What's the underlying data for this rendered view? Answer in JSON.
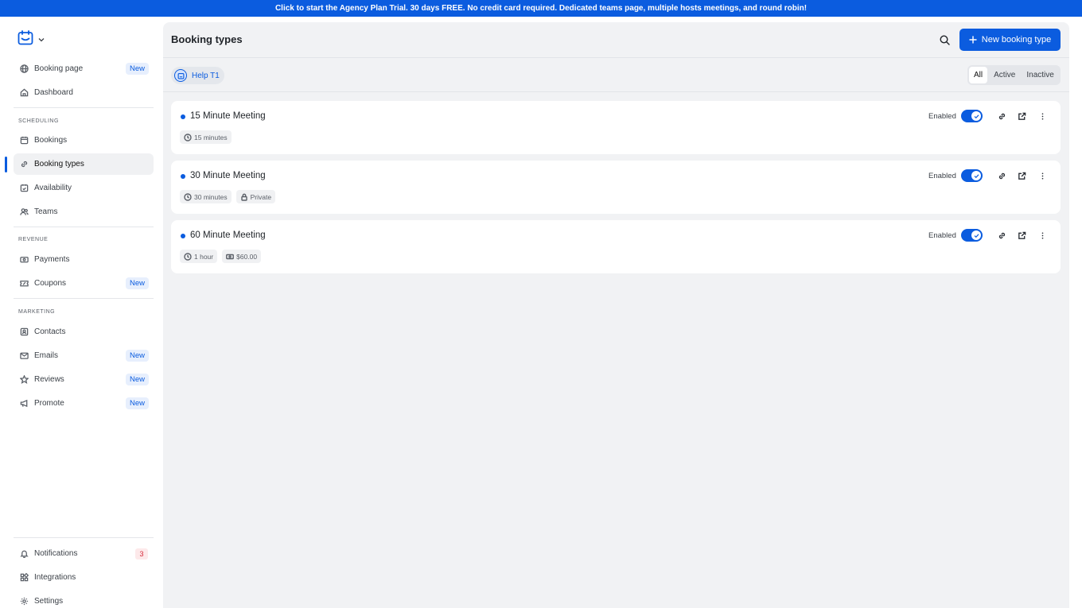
{
  "banner": {
    "text": "Click to start the Agency Plan Trial. 30 days FREE. No credit card required. Dedicated teams page, multiple hosts meetings, and round robin!"
  },
  "sidebar": {
    "top": [
      {
        "label": "Booking page",
        "badge": "New"
      },
      {
        "label": "Dashboard"
      }
    ],
    "scheduling_label": "SCHEDULING",
    "scheduling": [
      {
        "label": "Bookings"
      },
      {
        "label": "Booking types"
      },
      {
        "label": "Availability"
      },
      {
        "label": "Teams"
      }
    ],
    "revenue_label": "REVENUE",
    "revenue": [
      {
        "label": "Payments"
      },
      {
        "label": "Coupons",
        "badge": "New"
      }
    ],
    "marketing_label": "MARKETING",
    "marketing": [
      {
        "label": "Contacts"
      },
      {
        "label": "Emails",
        "badge": "New"
      },
      {
        "label": "Reviews",
        "badge": "New"
      },
      {
        "label": "Promote",
        "badge": "New"
      }
    ],
    "bottom": [
      {
        "label": "Notifications",
        "count": "3"
      },
      {
        "label": "Integrations"
      },
      {
        "label": "Settings"
      }
    ]
  },
  "header": {
    "title": "Booking types",
    "new_button": "New booking type"
  },
  "team": {
    "name": "Help T1"
  },
  "filters": {
    "tabs": [
      "All",
      "Active",
      "Inactive"
    ],
    "selected": "All"
  },
  "booking_types": [
    {
      "name": "15 Minute Meeting",
      "status": "Enabled",
      "chips": [
        {
          "icon": "clock-icon",
          "text": "15 minutes"
        }
      ]
    },
    {
      "name": "30 Minute Meeting",
      "status": "Enabled",
      "chips": [
        {
          "icon": "clock-icon",
          "text": "30 minutes"
        },
        {
          "icon": "lock-icon",
          "text": "Private"
        }
      ]
    },
    {
      "name": "60 Minute Meeting",
      "status": "Enabled",
      "chips": [
        {
          "icon": "clock-icon",
          "text": "1 hour"
        },
        {
          "icon": "money-icon",
          "text": "$60.00"
        }
      ]
    }
  ],
  "colors": {
    "accent": "#0b5cdf",
    "main_bg": "#f1f2f4",
    "badge_new_bg": "#e7effd",
    "count_red": "#d62a3a"
  }
}
